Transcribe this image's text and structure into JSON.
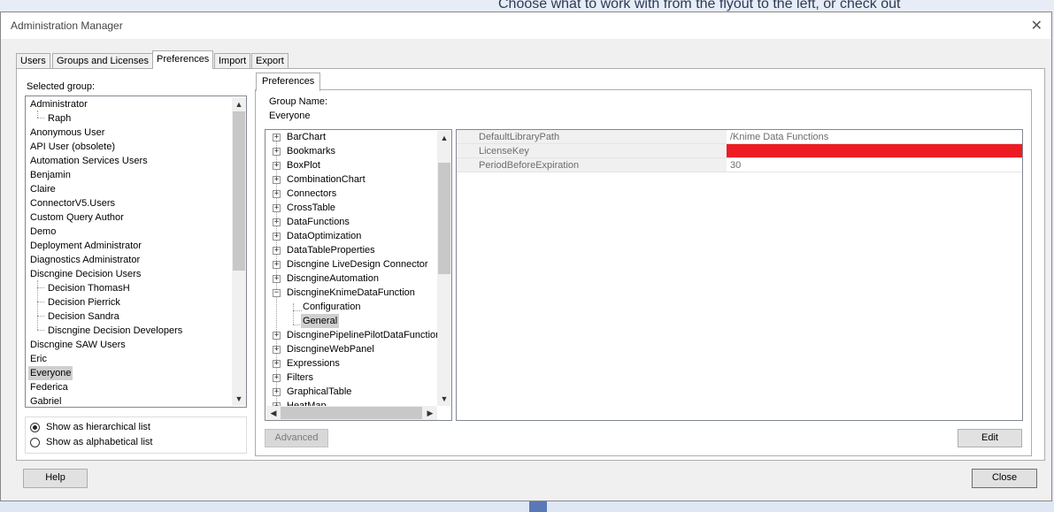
{
  "background": {
    "hint_text": "Choose what to work with from the flyout to the left, or check out"
  },
  "window": {
    "title": "Administration Manager",
    "close_glyph": "✕"
  },
  "tabs": [
    {
      "label": "Users",
      "active": false
    },
    {
      "label": "Groups and Licenses",
      "active": false
    },
    {
      "label": "Preferences",
      "active": true
    },
    {
      "label": "Import",
      "active": false
    },
    {
      "label": "Export",
      "active": false
    }
  ],
  "left_panel": {
    "selected_group_label": "Selected group:",
    "groups": [
      {
        "label": "Administrator",
        "level": 0
      },
      {
        "label": "Raph",
        "level": 1
      },
      {
        "label": "Anonymous User",
        "level": 0
      },
      {
        "label": "API User (obsolete)",
        "level": 0
      },
      {
        "label": "Automation Services Users",
        "level": 0
      },
      {
        "label": "Benjamin",
        "level": 0
      },
      {
        "label": "Claire",
        "level": 0
      },
      {
        "label": "ConnectorV5.Users",
        "level": 0
      },
      {
        "label": "Custom Query Author",
        "level": 0
      },
      {
        "label": "Demo",
        "level": 0
      },
      {
        "label": "Deployment Administrator",
        "level": 0
      },
      {
        "label": "Diagnostics Administrator",
        "level": 0
      },
      {
        "label": "Discngine Decision Users",
        "level": 0
      },
      {
        "label": "Decision ThomasH",
        "level": 1
      },
      {
        "label": "Decision Pierrick",
        "level": 1
      },
      {
        "label": "Decision Sandra",
        "level": 1
      },
      {
        "label": "Discngine Decision Developers",
        "level": 1
      },
      {
        "label": "Discngine SAW Users",
        "level": 0
      },
      {
        "label": "Eric",
        "level": 0
      },
      {
        "label": "Everyone",
        "level": 0,
        "selected": true
      },
      {
        "label": "Federica",
        "level": 0
      },
      {
        "label": "Gabriel",
        "level": 0
      }
    ],
    "view_options": [
      {
        "label": "Show as hierarchical list",
        "checked": true
      },
      {
        "label": "Show as alphabetical list",
        "checked": false
      }
    ]
  },
  "preferences": {
    "inner_tab_label": "Preferences",
    "group_name_label": "Group Name:",
    "group_name_value": "Everyone",
    "tree": [
      {
        "label": "BarChart",
        "level": 0,
        "expander": "+"
      },
      {
        "label": "Bookmarks",
        "level": 0,
        "expander": "+"
      },
      {
        "label": "BoxPlot",
        "level": 0,
        "expander": "+"
      },
      {
        "label": "CombinationChart",
        "level": 0,
        "expander": "+"
      },
      {
        "label": "Connectors",
        "level": 0,
        "expander": "+"
      },
      {
        "label": "CrossTable",
        "level": 0,
        "expander": "+"
      },
      {
        "label": "DataFunctions",
        "level": 0,
        "expander": "+"
      },
      {
        "label": "DataOptimization",
        "level": 0,
        "expander": "+"
      },
      {
        "label": "DataTableProperties",
        "level": 0,
        "expander": "+"
      },
      {
        "label": "Discngine LiveDesign Connector",
        "level": 0,
        "expander": "+"
      },
      {
        "label": "DiscngineAutomation",
        "level": 0,
        "expander": "+"
      },
      {
        "label": "DiscngineKnimeDataFunction",
        "level": 0,
        "expander": "−"
      },
      {
        "label": "Configuration",
        "level": 1,
        "expander": ""
      },
      {
        "label": "General",
        "level": 1,
        "expander": "",
        "selected": true
      },
      {
        "label": "DiscnginePipelinePilotDataFunction",
        "level": 0,
        "expander": "+"
      },
      {
        "label": "DiscngineWebPanel",
        "level": 0,
        "expander": "+"
      },
      {
        "label": "Expressions",
        "level": 0,
        "expander": "+"
      },
      {
        "label": "Filters",
        "level": 0,
        "expander": "+"
      },
      {
        "label": "GraphicalTable",
        "level": 0,
        "expander": "+"
      },
      {
        "label": "HeatMap",
        "level": 0,
        "expander": "+"
      }
    ],
    "properties": [
      {
        "name": "DefaultLibraryPath",
        "value": "/Knime Data Functions",
        "redacted": false
      },
      {
        "name": "LicenseKey",
        "value": "",
        "redacted": true
      },
      {
        "name": "PeriodBeforeExpiration",
        "value": "30",
        "redacted": false
      }
    ],
    "advanced_button": "Advanced",
    "edit_button": "Edit"
  },
  "footer": {
    "help_button": "Help",
    "close_button": "Close"
  },
  "colors": {
    "redacted": "#ed1c24",
    "selection": "#cfcfcf"
  }
}
